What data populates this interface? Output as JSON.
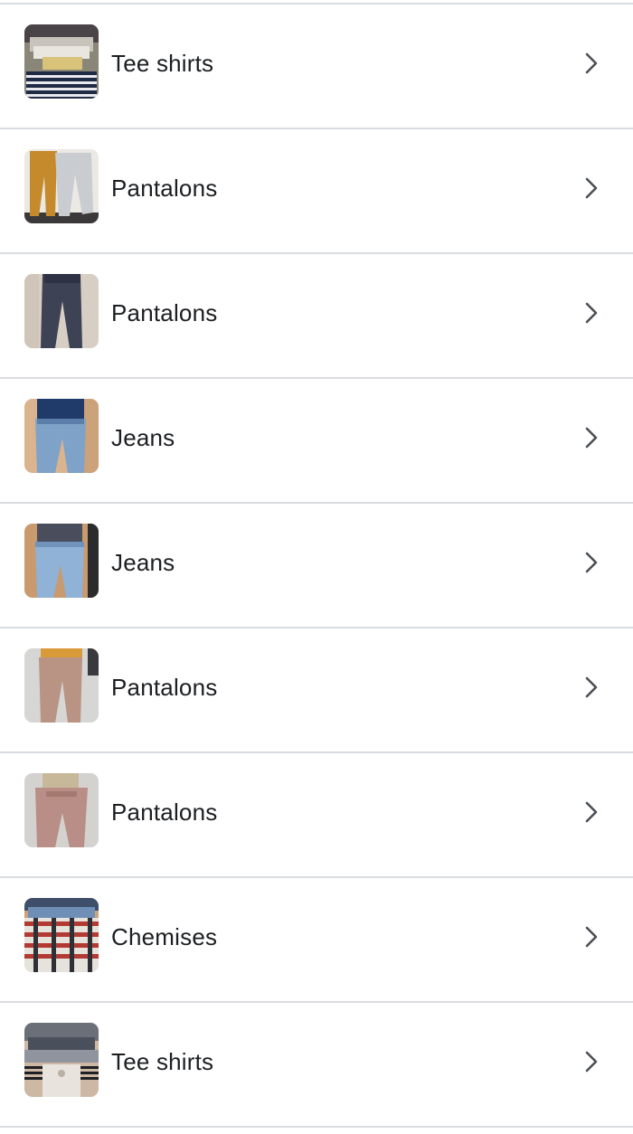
{
  "items": [
    {
      "label": "Tee shirts",
      "icon": "thumbnail-tee-shirts-image",
      "chevron": "chevron-right-icon"
    },
    {
      "label": "Pantalons",
      "icon": "thumbnail-pants-image",
      "chevron": "chevron-right-icon"
    },
    {
      "label": "Pantalons",
      "icon": "thumbnail-pants-image",
      "chevron": "chevron-right-icon"
    },
    {
      "label": "Jeans",
      "icon": "thumbnail-jeans-image",
      "chevron": "chevron-right-icon"
    },
    {
      "label": "Jeans",
      "icon": "thumbnail-jeans-image",
      "chevron": "chevron-right-icon"
    },
    {
      "label": "Pantalons",
      "icon": "thumbnail-pants-image",
      "chevron": "chevron-right-icon"
    },
    {
      "label": "Pantalons",
      "icon": "thumbnail-pants-image",
      "chevron": "chevron-right-icon"
    },
    {
      "label": "Chemises",
      "icon": "thumbnail-shirts-image",
      "chevron": "chevron-right-icon"
    },
    {
      "label": "Tee shirts",
      "icon": "thumbnail-tee-shirts-image",
      "chevron": "chevron-right-icon"
    }
  ],
  "colors": {
    "text": "#1c1e21",
    "divider": "#d9dcdf",
    "chevron": "#4b4f56",
    "background": "#ffffff"
  }
}
